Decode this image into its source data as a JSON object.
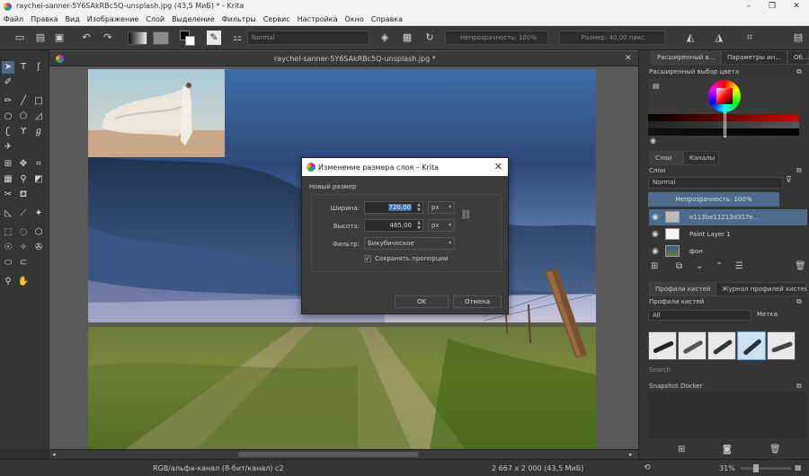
{
  "window": {
    "title": "raychel-sanner-5Y6SAkRBc5Q-unsplash.jpg (43,5 МиБ)  * - Krita",
    "minimize": "–",
    "maximize": "❐",
    "close": "✕"
  },
  "menu": [
    "Файл",
    "Правка",
    "Вид",
    "Изображение",
    "Слой",
    "Выделение",
    "Фильтры",
    "Сервис",
    "Настройка",
    "Окно",
    "Справка"
  ],
  "toolbar": {
    "blend_mode": "Normal",
    "opacity": "Непрозрачность: 100%",
    "size": "Размер: 40,00 пикс."
  },
  "document": {
    "tab_title": "raychel-sanner-5Y6SAkRBc5Q-unsplash.jpg *",
    "close": "✕"
  },
  "status": {
    "color_model": "RGB/альфа-канал (8-бит/канал)  c2",
    "dimensions": "2 667 x 2 000 (43,5 МиБ)",
    "zoom": "31%"
  },
  "right_panel": {
    "top_tabs": [
      "Расширенный в...",
      "Параметры ин...",
      "Об..."
    ],
    "color_selector_title": "Расширенный выбор цвета",
    "layer_tabs": [
      "Слои",
      "Каналы"
    ],
    "layers_title": "Слои",
    "blend_mode": "Normal",
    "opacity": "Непрозрачность:  100%",
    "layers": [
      {
        "name": "e113be11213d317e..."
      },
      {
        "name": "Paint Layer 1"
      },
      {
        "name": "фон"
      }
    ],
    "brush_tabs": [
      "Профили кистей",
      "Журнал профилей кистей"
    ],
    "brush_title": "Профили кистей",
    "brush_filter": "All",
    "brush_tag": "Метка",
    "search_label": "Search",
    "snapshot_title": "Snapshot Docker"
  },
  "dialog": {
    "title": "Изменение размера слоя – Krita",
    "close": "✕",
    "group_label": "Новый размер",
    "width_label": "Ширина:",
    "width_value": "720,00",
    "width_unit": "px",
    "height_label": "Высота:",
    "height_value": "465,00",
    "height_unit": "px",
    "filter_label": "Фильтр:",
    "filter_value": "Бикубическое",
    "keep_ratio_label": "Сохранять пропорции",
    "keep_ratio": true,
    "ok": "OK",
    "cancel": "Отмена"
  }
}
